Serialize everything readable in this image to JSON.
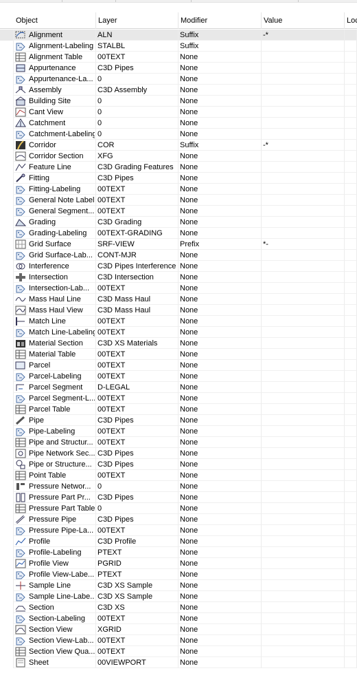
{
  "columns": [
    "Object",
    "Layer",
    "Modifier",
    "Value",
    "Loc"
  ],
  "rows": [
    {
      "object": "Alignment",
      "layer": "ALN",
      "modifier": "Suffix",
      "value": "-*",
      "icon": "alignment-icon",
      "selected": true
    },
    {
      "object": "Alignment-Labeling",
      "layer": "STALBL",
      "modifier": "Suffix",
      "value": "",
      "icon": "tag-label-icon"
    },
    {
      "object": "Alignment Table",
      "layer": "00TEXT",
      "modifier": "None",
      "value": "",
      "icon": "table-icon"
    },
    {
      "object": "Appurtenance",
      "layer": "C3D Pipes",
      "modifier": "None",
      "value": "",
      "icon": "appurtenance-icon"
    },
    {
      "object": "Appurtenance-La...",
      "layer": "0",
      "modifier": "None",
      "value": "",
      "icon": "tag-label-icon"
    },
    {
      "object": "Assembly",
      "layer": "C3D Assembly",
      "modifier": "None",
      "value": "",
      "icon": "assembly-icon"
    },
    {
      "object": "Building Site",
      "layer": "0",
      "modifier": "None",
      "value": "",
      "icon": "building-site-icon"
    },
    {
      "object": "Cant View",
      "layer": "0",
      "modifier": "None",
      "value": "",
      "icon": "cant-view-icon"
    },
    {
      "object": "Catchment",
      "layer": "0",
      "modifier": "None",
      "value": "",
      "icon": "catchment-icon"
    },
    {
      "object": "Catchment-Labeling",
      "layer": "0",
      "modifier": "None",
      "value": "",
      "icon": "tag-label-icon"
    },
    {
      "object": "Corridor",
      "layer": "COR",
      "modifier": "Suffix",
      "value": "-*",
      "icon": "corridor-icon"
    },
    {
      "object": "Corridor Section",
      "layer": "XFG",
      "modifier": "None",
      "value": "",
      "icon": "corridor-section-icon"
    },
    {
      "object": "Feature Line",
      "layer": "C3D Grading Features",
      "modifier": "None",
      "value": "",
      "icon": "feature-line-icon"
    },
    {
      "object": "Fitting",
      "layer": "C3D Pipes",
      "modifier": "None",
      "value": "",
      "icon": "fitting-icon"
    },
    {
      "object": "Fitting-Labeling",
      "layer": "00TEXT",
      "modifier": "None",
      "value": "",
      "icon": "tag-label-icon"
    },
    {
      "object": "General Note Label",
      "layer": "00TEXT",
      "modifier": "None",
      "value": "",
      "icon": "tag-label-icon"
    },
    {
      "object": "General Segment...",
      "layer": "00TEXT",
      "modifier": "None",
      "value": "",
      "icon": "tag-label-icon"
    },
    {
      "object": "Grading",
      "layer": "C3D Grading",
      "modifier": "None",
      "value": "",
      "icon": "grading-icon"
    },
    {
      "object": "Grading-Labeling",
      "layer": "00TEXT-GRADING",
      "modifier": "None",
      "value": "",
      "icon": "tag-label-icon"
    },
    {
      "object": "Grid Surface",
      "layer": "SRF-VIEW",
      "modifier": "Prefix",
      "value": "*-",
      "icon": "grid-surface-icon"
    },
    {
      "object": "Grid Surface-Lab...",
      "layer": "CONT-MJR",
      "modifier": "None",
      "value": "",
      "icon": "tag-label-icon"
    },
    {
      "object": "Interference",
      "layer": "C3D Pipes Interference",
      "modifier": "None",
      "value": "",
      "icon": "interference-icon"
    },
    {
      "object": "Intersection",
      "layer": "C3D Intersection",
      "modifier": "None",
      "value": "",
      "icon": "intersection-icon"
    },
    {
      "object": "Intersection-Lab...",
      "layer": "00TEXT",
      "modifier": "None",
      "value": "",
      "icon": "tag-label-icon"
    },
    {
      "object": "Mass Haul Line",
      "layer": "C3D Mass Haul",
      "modifier": "None",
      "value": "",
      "icon": "mass-haul-line-icon"
    },
    {
      "object": "Mass Haul View",
      "layer": "C3D Mass Haul",
      "modifier": "None",
      "value": "",
      "icon": "mass-haul-view-icon"
    },
    {
      "object": "Match Line",
      "layer": "00TEXT",
      "modifier": "None",
      "value": "",
      "icon": "match-line-icon"
    },
    {
      "object": "Match Line-Labeling",
      "layer": "00TEXT",
      "modifier": "None",
      "value": "",
      "icon": "tag-label-icon"
    },
    {
      "object": "Material Section",
      "layer": "C3D XS Materials",
      "modifier": "None",
      "value": "",
      "icon": "material-section-icon"
    },
    {
      "object": "Material Table",
      "layer": "00TEXT",
      "modifier": "None",
      "value": "",
      "icon": "table-icon"
    },
    {
      "object": "Parcel",
      "layer": "00TEXT",
      "modifier": "None",
      "value": "",
      "icon": "parcel-icon"
    },
    {
      "object": "Parcel-Labeling",
      "layer": "00TEXT",
      "modifier": "None",
      "value": "",
      "icon": "tag-label-icon"
    },
    {
      "object": "Parcel Segment",
      "layer": "D-LEGAL",
      "modifier": "None",
      "value": "",
      "icon": "parcel-segment-icon"
    },
    {
      "object": "Parcel Segment-L...",
      "layer": "00TEXT",
      "modifier": "None",
      "value": "",
      "icon": "tag-label-icon"
    },
    {
      "object": "Parcel Table",
      "layer": "00TEXT",
      "modifier": "None",
      "value": "",
      "icon": "table-icon"
    },
    {
      "object": "Pipe",
      "layer": "C3D Pipes",
      "modifier": "None",
      "value": "",
      "icon": "pipe-icon"
    },
    {
      "object": "Pipe-Labeling",
      "layer": "00TEXT",
      "modifier": "None",
      "value": "",
      "icon": "tag-label-icon"
    },
    {
      "object": "Pipe and Structur...",
      "layer": "00TEXT",
      "modifier": "None",
      "value": "",
      "icon": "table-icon"
    },
    {
      "object": "Pipe Network Sec...",
      "layer": "C3D Pipes",
      "modifier": "None",
      "value": "",
      "icon": "pipe-network-section-icon"
    },
    {
      "object": "Pipe or Structure...",
      "layer": "C3D Pipes",
      "modifier": "None",
      "value": "",
      "icon": "pipe-structure-icon"
    },
    {
      "object": "Point Table",
      "layer": "00TEXT",
      "modifier": "None",
      "value": "",
      "icon": "table-icon"
    },
    {
      "object": "Pressure Networ...",
      "layer": "0",
      "modifier": "None",
      "value": "",
      "icon": "pressure-network-icon"
    },
    {
      "object": "Pressure Part Pr...",
      "layer": "C3D Pipes",
      "modifier": "None",
      "value": "",
      "icon": "pressure-part-icon"
    },
    {
      "object": "Pressure Part Table",
      "layer": "0",
      "modifier": "None",
      "value": "",
      "icon": "table-icon"
    },
    {
      "object": "Pressure Pipe",
      "layer": "C3D Pipes",
      "modifier": "None",
      "value": "",
      "icon": "pressure-pipe-icon"
    },
    {
      "object": "Pressure Pipe-La...",
      "layer": "00TEXT",
      "modifier": "None",
      "value": "",
      "icon": "tag-label-icon"
    },
    {
      "object": "Profile",
      "layer": "C3D Profile",
      "modifier": "None",
      "value": "",
      "icon": "profile-icon"
    },
    {
      "object": "Profile-Labeling",
      "layer": "PTEXT",
      "modifier": "None",
      "value": "",
      "icon": "tag-label-icon"
    },
    {
      "object": "Profile View",
      "layer": "PGRID",
      "modifier": "None",
      "value": "",
      "icon": "profile-view-icon"
    },
    {
      "object": "Profile View-Labe...",
      "layer": "PTEXT",
      "modifier": "None",
      "value": "",
      "icon": "tag-label-icon"
    },
    {
      "object": "Sample Line",
      "layer": "C3D XS Sample",
      "modifier": "None",
      "value": "",
      "icon": "sample-line-icon"
    },
    {
      "object": "Sample Line-Labe...",
      "layer": "C3D XS Sample",
      "modifier": "None",
      "value": "",
      "icon": "tag-label-icon"
    },
    {
      "object": "Section",
      "layer": "C3D XS",
      "modifier": "None",
      "value": "",
      "icon": "section-icon"
    },
    {
      "object": "Section-Labeling",
      "layer": "00TEXT",
      "modifier": "None",
      "value": "",
      "icon": "tag-label-icon"
    },
    {
      "object": "Section View",
      "layer": "XGRID",
      "modifier": "None",
      "value": "",
      "icon": "section-view-icon"
    },
    {
      "object": "Section View-Lab...",
      "layer": "00TEXT",
      "modifier": "None",
      "value": "",
      "icon": "tag-label-icon"
    },
    {
      "object": "Section View Qua...",
      "layer": "00TEXT",
      "modifier": "None",
      "value": "",
      "icon": "table-icon"
    },
    {
      "object": "Sheet",
      "layer": "00VIEWPORT",
      "modifier": "None",
      "value": "",
      "icon": "sheet-icon"
    }
  ]
}
